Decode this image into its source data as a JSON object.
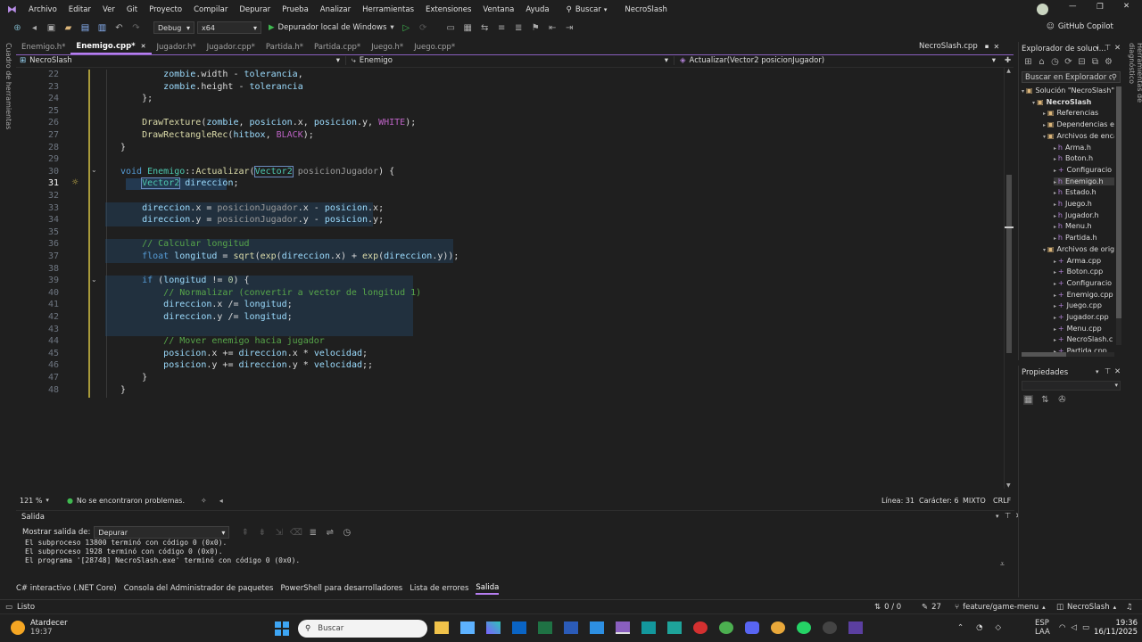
{
  "menu": [
    "Archivo",
    "Editar",
    "Ver",
    "Git",
    "Proyecto",
    "Compilar",
    "Depurar",
    "Prueba",
    "Analizar",
    "Herramientas",
    "Extensiones",
    "Ventana",
    "Ayuda"
  ],
  "search_label": "Buscar",
  "solution_title": "NecroSlash",
  "avatar_letter": "",
  "copilot": "GitHub Copilot",
  "toolbar": {
    "config": "Debug",
    "platform": "x64",
    "run": "Depurador local de Windows"
  },
  "tabs": [
    {
      "label": "Enemigo.h*",
      "active": false
    },
    {
      "label": "Enemigo.cpp*",
      "active": true
    },
    {
      "label": "Jugador.h*",
      "active": false
    },
    {
      "label": "Jugador.cpp*",
      "active": false
    },
    {
      "label": "Partida.h*",
      "active": false
    },
    {
      "label": "Partida.cpp*",
      "active": false
    },
    {
      "label": "Juego.h*",
      "active": false
    },
    {
      "label": "Juego.cpp*",
      "active": false
    }
  ],
  "right_tab": "NecroSlash.cpp",
  "nav": {
    "project": "NecroSlash",
    "scope": "Enemigo",
    "member": "Actualizar(Vector2 posicionJugador)"
  },
  "line_numbers": [
    "22",
    "23",
    "24",
    "25",
    "26",
    "27",
    "28",
    "29",
    "30",
    "31",
    "32",
    "33",
    "34",
    "35",
    "36",
    "37",
    "38",
    "39",
    "40",
    "41",
    "42",
    "43",
    "44",
    "45",
    "46",
    "47",
    "48"
  ],
  "editor_status": {
    "zoom": "121 %",
    "problems": "No se encontraron problemas.",
    "line": "Línea: 31",
    "char": "Carácter: 6",
    "mixed": "MIXTO",
    "eol": "CRLF"
  },
  "output": {
    "title": "Salida",
    "show_label": "Mostrar salida de:",
    "source": "Depurar",
    "lines": [
      "El subproceso 13800 terminó con código 0 (0x0).",
      "El subproceso 1928 terminó con código 0 (0x0).",
      "El programa '[28748] NecroSlash.exe' terminó con código 0 (0x0)."
    ]
  },
  "bottom_tabs": [
    "C# interactivo (.NET Core)",
    "Consola del Administrador de paquetes",
    "PowerShell para desarrolladores",
    "Lista de errores",
    "Salida"
  ],
  "status": {
    "ready": "Listo",
    "changes": "0 / 0",
    "commits": "27",
    "branch": "feature/game-menu",
    "repo": "NecroSlash"
  },
  "solution_explorer": {
    "title": "Explorador de soluci...",
    "search": "Buscar en Explorador de s",
    "items": [
      {
        "label": "Solución \"NecroSlash\"",
        "indent": 0,
        "bold": false
      },
      {
        "label": "NecroSlash",
        "indent": 1,
        "bold": true
      },
      {
        "label": "Referencias",
        "indent": 2,
        "bold": false
      },
      {
        "label": "Dependencias ex",
        "indent": 2,
        "bold": false
      },
      {
        "label": "Archivos de enca",
        "indent": 2,
        "bold": false
      },
      {
        "label": "Arma.h",
        "indent": 3,
        "bold": false
      },
      {
        "label": "Boton.h",
        "indent": 3,
        "bold": false
      },
      {
        "label": "Configuracio",
        "indent": 3,
        "bold": false
      },
      {
        "label": "Enemigo.h",
        "indent": 3,
        "bold": false
      },
      {
        "label": "Estado.h",
        "indent": 3,
        "bold": false
      },
      {
        "label": "Juego.h",
        "indent": 3,
        "bold": false
      },
      {
        "label": "Jugador.h",
        "indent": 3,
        "bold": false
      },
      {
        "label": "Menu.h",
        "indent": 3,
        "bold": false
      },
      {
        "label": "Partida.h",
        "indent": 3,
        "bold": false
      },
      {
        "label": "Archivos de orig",
        "indent": 2,
        "bold": false
      },
      {
        "label": "Arma.cpp",
        "indent": 3,
        "bold": false
      },
      {
        "label": "Boton.cpp",
        "indent": 3,
        "bold": false
      },
      {
        "label": "Configuracio",
        "indent": 3,
        "bold": false
      },
      {
        "label": "Enemigo.cpp",
        "indent": 3,
        "bold": false
      },
      {
        "label": "Juego.cpp",
        "indent": 3,
        "bold": false
      },
      {
        "label": "Jugador.cpp",
        "indent": 3,
        "bold": false
      },
      {
        "label": "Menu.cpp",
        "indent": 3,
        "bold": false
      },
      {
        "label": "NecroSlash.c",
        "indent": 3,
        "bold": false
      },
      {
        "label": "Partida.cpp",
        "indent": 3,
        "bold": false
      }
    ]
  },
  "properties_title": "Propiedades",
  "left_side": "Cuadro de herramientas",
  "right_side": "Herramientas de diagnóstico",
  "taskbar": {
    "weather_title": "Atardecer",
    "weather_time": "19:37",
    "search": "Buscar",
    "lang": "ESP",
    "lang2": "LAA",
    "time": "19:36",
    "date": "16/11/2025"
  }
}
